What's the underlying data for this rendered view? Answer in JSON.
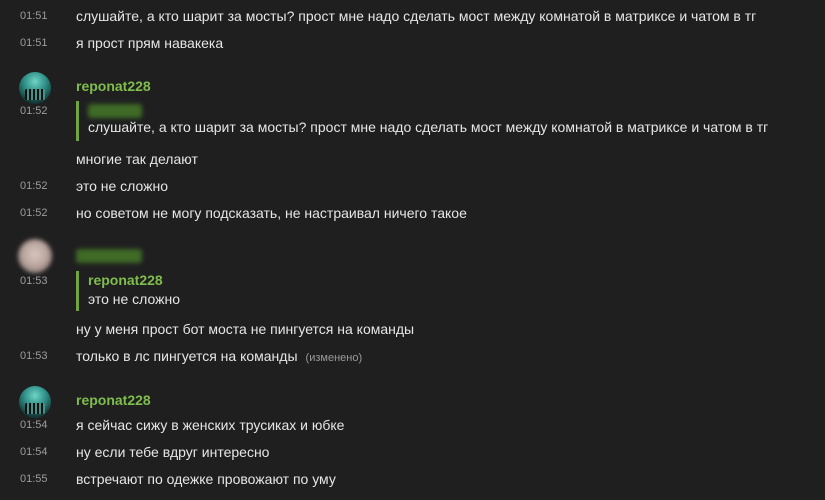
{
  "messages": [
    {
      "time": "01:51",
      "text": "слушайте, а кто шарит за мосты? прост мне надо сделать мост между комнатой в матриксе и чатом в тг"
    },
    {
      "time": "01:51",
      "text": "я прост прям навакека"
    }
  ],
  "group1": {
    "sender": "reponat228",
    "time": "01:52",
    "quote_text": "слушайте, а кто шарит за мосты? прост мне надо сделать мост между комнатой в матриксе и чатом в тг",
    "after_quote": "многие так делают",
    "lines": [
      {
        "time": "01:52",
        "text": "это не сложно"
      },
      {
        "time": "01:52",
        "text": "но советом не могу подсказать, не настраивал ничего такое"
      }
    ]
  },
  "group2": {
    "time": "01:53",
    "quote_sender": "reponat228",
    "quote_text": "это не сложно",
    "after_quote": "ну у меня прост бот моста не пингуется на команды",
    "lines": [
      {
        "time": "01:53",
        "text": "только в лс пингуется на команды",
        "edited": "(изменено)"
      }
    ]
  },
  "group3": {
    "sender": "reponat228",
    "lines": [
      {
        "time": "01:54",
        "text": "я сейчас сижу в женских трусиках и юбке"
      },
      {
        "time": "01:54",
        "text": "ну если тебе вдруг интересно"
      },
      {
        "time": "01:55",
        "text": "встречают по одежке провожают по уму"
      }
    ]
  },
  "colors": {
    "background": "#1f1f20",
    "sender": "#7fbd4c",
    "quote_bar": "#6fa43f",
    "text": "#e6e6e6",
    "timestamp": "#9c9c9c"
  }
}
